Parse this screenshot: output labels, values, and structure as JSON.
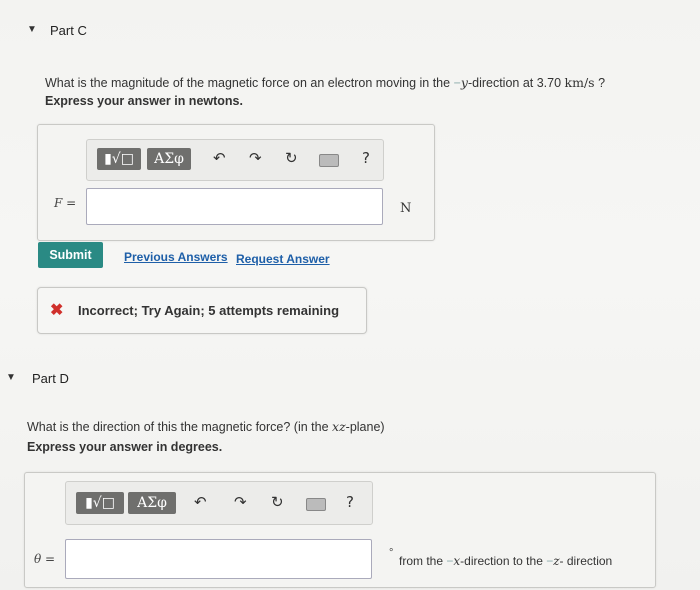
{
  "part_c": {
    "title": "Part C",
    "question_prefix": "What is the magnitude of the magnetic force on an electron moving in the ",
    "question_neg": "−",
    "question_var": "y",
    "question_mid": "-direction at 3.70 ",
    "question_unit": "km/s",
    "question_suffix": " ?",
    "instruction": "Express your answer in newtons.",
    "toolbar": {
      "templates_label": "▮√□",
      "greek_label": "ΑΣφ",
      "undo_label": "↶",
      "redo_label": "↷",
      "reset_label": "↻",
      "help_label": "?"
    },
    "variable_label": "F =",
    "answer_value": "",
    "unit": "N",
    "submit_label": "Submit",
    "previous_answers_label": "Previous Answers",
    "request_answer_label": "Request Answer",
    "feedback_icon": "✖",
    "feedback_text": "Incorrect; Try Again; 5 attempts remaining"
  },
  "part_d": {
    "title": "Part D",
    "question_prefix": "What is the direction of this the magnetic force? (in the ",
    "question_var": "xz",
    "question_suffix": "-plane)",
    "instruction": "Express your answer in degrees.",
    "toolbar": {
      "templates_label": "▮√□",
      "greek_label": "ΑΣφ",
      "undo_label": "↶",
      "redo_label": "↷",
      "reset_label": "↻",
      "help_label": "?"
    },
    "variable_label": "θ =",
    "answer_value": "",
    "degree_symbol": "°",
    "suffix_prefix": "from the ",
    "suffix_neg1": "−",
    "suffix_var1": "x",
    "suffix_mid": "-direction to the ",
    "suffix_neg2": "−",
    "suffix_var2": "z",
    "suffix_end": "- direction"
  },
  "colors": {
    "submit": "#2a8a84",
    "link": "#1e5fa8",
    "error": "#d0302b",
    "toolbar_button": "#6f6f6d"
  }
}
